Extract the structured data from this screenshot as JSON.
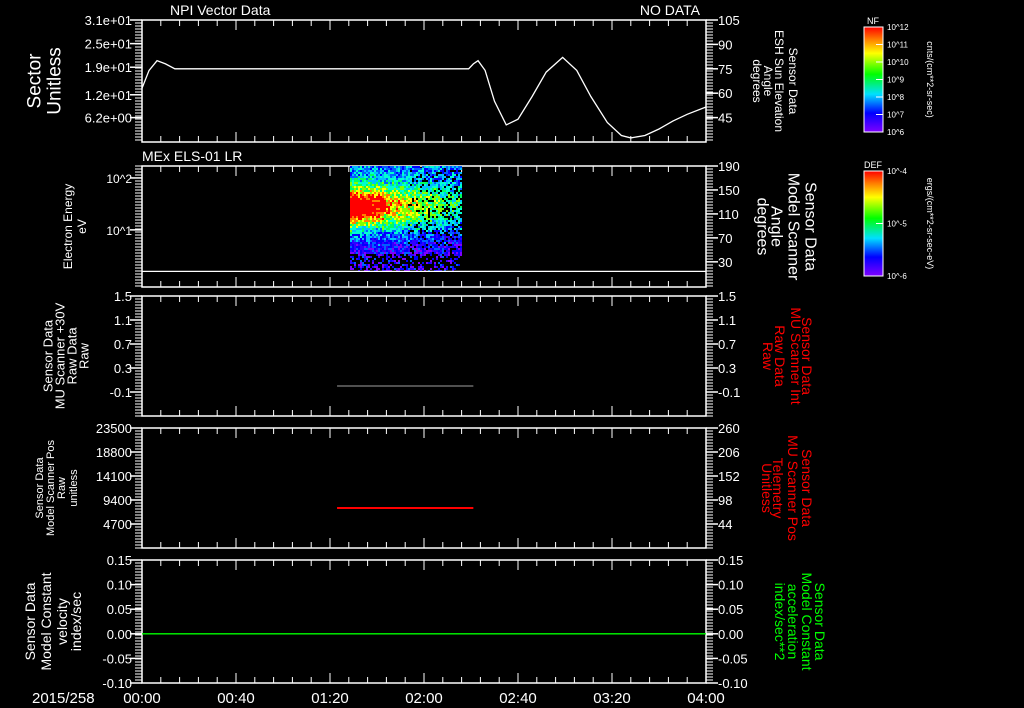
{
  "header": {
    "title_left": "NPI Vector Data",
    "title_right": "NO DATA",
    "panel2_title": "MEx ELS-01 LR",
    "date_label": "2015/258"
  },
  "time_axis": {
    "start": "00:00",
    "end": "04:00",
    "tick_labels": [
      "00:00",
      "00:40",
      "01:20",
      "02:00",
      "02:40",
      "03:20",
      "04:00"
    ]
  },
  "colors": {
    "white": "#ffffff",
    "red": "#ff0000",
    "green": "#00ff00",
    "gray": "#808080",
    "background": "#000000"
  },
  "colorbars": [
    {
      "title": "NF",
      "tick_labels": [
        "10^12",
        "10^11",
        "10^10",
        "10^9",
        "10^8",
        "10^7",
        "10^6"
      ],
      "units": "cnts/(cm**2-sr-sec)"
    },
    {
      "title": "DEF",
      "tick_labels": [
        "10^-4",
        "10^-5",
        "10^-6"
      ],
      "units": "ergs/(cm**2-sr-sec-eV)"
    }
  ],
  "chart_data": [
    {
      "type": "line",
      "title": "NPI Vector Data",
      "left_label": [
        "Sector",
        "Unitless"
      ],
      "left_ticks": [
        "3.1e+01",
        "2.5e+01",
        "1.9e+01",
        "1.2e+01",
        "6.2e+00"
      ],
      "left_ylim": [
        0,
        31
      ],
      "right_label": [
        "Sensor Data",
        "ESH Sun Elevation",
        "Angle",
        "degrees"
      ],
      "right_label_color": "#ffffff",
      "right_ticks": [
        "105",
        "90",
        "75",
        "60",
        "45"
      ],
      "right_ylim": [
        30,
        105
      ],
      "series": [
        {
          "name": "ESH Sun Elevation Angle",
          "axis": "right",
          "color": "#ffffff",
          "x_min": [
            0,
            3,
            6.4,
            10,
            14,
            60,
            100,
            139,
            141,
            143,
            146,
            150,
            155,
            160,
            166,
            172,
            179,
            185,
            191,
            198,
            204,
            208,
            214,
            220,
            226,
            232,
            240
          ],
          "y": [
            63,
            74,
            80,
            78,
            75,
            75,
            75,
            75,
            78,
            80,
            74,
            55,
            40.5,
            44,
            58,
            73,
            82,
            74,
            58,
            42,
            34,
            32.5,
            34,
            38,
            43,
            47,
            51.5
          ]
        }
      ]
    },
    {
      "type": "heatmap",
      "title": "MEx ELS-01 LR",
      "left_label": [
        "Electron Energy",
        "eV"
      ],
      "left_ticks": [
        "10^2",
        "10^1"
      ],
      "left_ylim_log10": [
        -0.1,
        2.23
      ],
      "right_label": [
        "Sensor Data",
        "Model Scanner",
        "Angle",
        "degrees"
      ],
      "right_label_color": "#ffffff",
      "right_ticks": [
        "190",
        "150",
        "110",
        "70",
        "30"
      ],
      "right_ylim": [
        -12,
        190
      ],
      "heatmap": {
        "x_range_min": [
          88,
          136
        ],
        "energy_range_eV": [
          2,
          170
        ],
        "peak_energy_eV": 35,
        "peak_time_min": 95,
        "colorbar": "DEF"
      },
      "series": [
        {
          "name": "Model Scanner Angle",
          "axis": "right",
          "color": "#ffffff",
          "x_min": [
            0,
            240
          ],
          "y": [
            14,
            14
          ]
        }
      ]
    },
    {
      "type": "line",
      "left_label": [
        "Sensor Data",
        "MU Scanner +30V",
        "Raw Data",
        "Raw"
      ],
      "left_ticks": [
        "1.5",
        "1.1",
        "0.7",
        "0.3",
        "-0.1"
      ],
      "left_ylim": [
        -0.5,
        1.5
      ],
      "right_label": [
        "Sensor Data",
        "MU Scanner Int",
        "Raw Data",
        "Raw"
      ],
      "right_label_color": "#ff0000",
      "right_ticks": [
        "1.5",
        "1.1",
        "0.7",
        "0.3",
        "-0.1"
      ],
      "right_ylim": [
        -0.5,
        1.5
      ],
      "series": [
        {
          "name": "MU Scanner Int",
          "axis": "right",
          "color": "#808080",
          "x_min": [
            83,
            141
          ],
          "y": [
            0,
            0
          ]
        }
      ]
    },
    {
      "type": "line",
      "left_label": [
        "Sensor Data",
        "Model Scanner Pos",
        "Raw",
        "unitless"
      ],
      "left_ticks": [
        "23500",
        "18800",
        "14100",
        "9400",
        "4700"
      ],
      "left_ylim": [
        0,
        23500
      ],
      "right_label": [
        "Sensor Data",
        "MU Scanner Pos",
        "Telemetry",
        "Unitless"
      ],
      "right_label_color": "#ff0000",
      "right_ticks": [
        "260",
        "206",
        "152",
        "98",
        "44"
      ],
      "right_ylim": [
        -10,
        260
      ],
      "series": [
        {
          "name": "MU Scanner Pos Telemetry",
          "axis": "left",
          "color": "#ff0000",
          "x_min": [
            83,
            141
          ],
          "y": [
            7830,
            7830
          ]
        }
      ]
    },
    {
      "type": "line",
      "left_label": [
        "Sensor Data",
        "Model Constant",
        "velocity",
        "index/sec"
      ],
      "left_ticks": [
        "0.15",
        "0.10",
        "0.05",
        "0.00",
        "-0.05",
        "-0.10"
      ],
      "left_ylim": [
        -0.1,
        0.15
      ],
      "right_label": [
        "Sensor Data",
        "Model Constant",
        "acceleration",
        "index/sec**2"
      ],
      "right_label_color": "#00ff00",
      "right_ticks": [
        "0.15",
        "0.10",
        "0.05",
        "0.00",
        "-0.05",
        "-0.10"
      ],
      "right_ylim": [
        -0.1,
        0.15
      ],
      "series": [
        {
          "name": "Model Constant velocity",
          "axis": "left",
          "color": "#00ff00",
          "x_min": [
            0,
            240
          ],
          "y": [
            0,
            0
          ]
        }
      ]
    }
  ]
}
